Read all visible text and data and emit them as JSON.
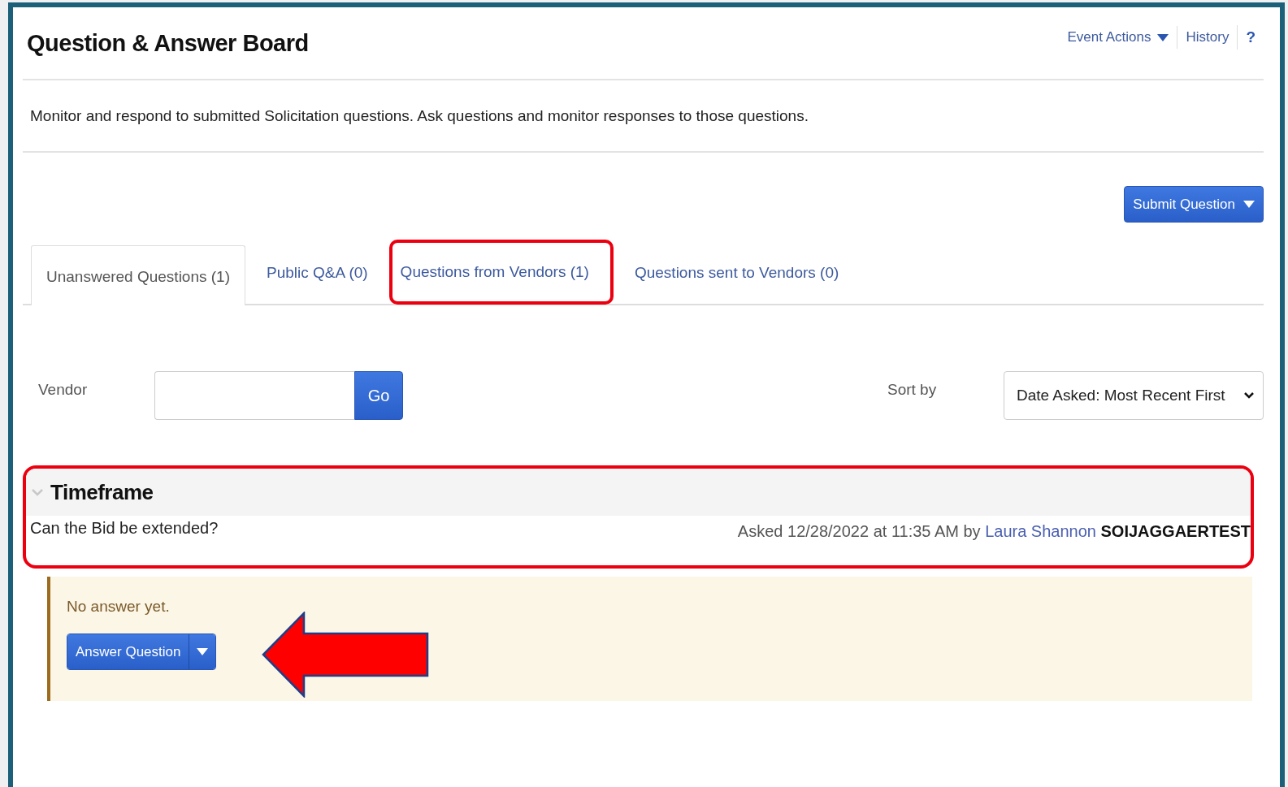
{
  "header": {
    "title": "Question & Answer Board",
    "actions": [
      {
        "label": "Event Actions",
        "kind": "dropdown"
      },
      {
        "label": "History",
        "kind": "link"
      },
      {
        "label": "?",
        "kind": "help"
      }
    ]
  },
  "description": "Monitor and respond to submitted Solicitation questions. Ask questions and monitor responses to those questions.",
  "submit_button": {
    "label": "Submit Question"
  },
  "tabs": [
    {
      "label": "Unanswered Questions (1)",
      "selected": true,
      "highlighted": false
    },
    {
      "label": "Public Q&A (0)",
      "selected": false,
      "highlighted": false
    },
    {
      "label": "Questions from Vendors (1)",
      "selected": false,
      "highlighted": true
    },
    {
      "label": "Questions sent to Vendors (0)",
      "selected": false,
      "highlighted": false
    }
  ],
  "filter": {
    "vendor_label": "Vendor",
    "go_button": "Go",
    "sort_label": "Sort by",
    "sort_value": "Date Asked: Most Recent First"
  },
  "question_groups": [
    {
      "title": "Timeframe",
      "expanded": true,
      "highlighted": true,
      "question": "Can the Bid be extended?",
      "asked": "Asked 12/28/2022 at 11:35 AM by",
      "author": "Laura Shannon",
      "organization": "SOIJAGGAERTEST",
      "answer_status": "No answer yet.",
      "answer_button": "Answer Question",
      "pointed_at": true
    }
  ]
}
